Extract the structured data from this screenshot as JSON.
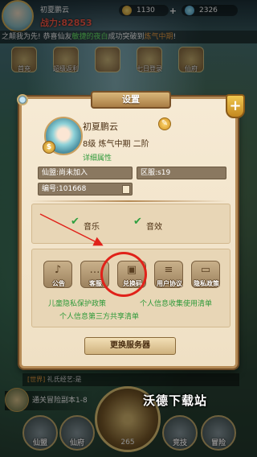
{
  "hud": {
    "player_name": "初夏鹏云",
    "power_label": "战力:82853",
    "currency_1": "1130",
    "currency_2": "2326",
    "broadcast_prefix": "之颠我为先! 恭喜仙友",
    "broadcast_name": "敏捷的夜白",
    "broadcast_mid": "成功突破到",
    "broadcast_realm": "炼气中期",
    "broadcast_suffix": "!",
    "top_icons": [
      "首充",
      "超级返利",
      "",
      "七日登录",
      "仙府"
    ],
    "chat_tag": "[世界]",
    "chat_text": "礼氏经艺:是",
    "quest_text": "通关冒险副本1-8",
    "hammer_count": "265",
    "nav": [
      "仙盟",
      "仙府",
      "",
      "竞技",
      "冒险"
    ],
    "watermark": "沃德下载站"
  },
  "dialog": {
    "title": "设置",
    "close_label": "+",
    "profile": {
      "name": "初夏鹏云",
      "level": "8级 炼气中期 二阶",
      "detail_link": "详细属性"
    },
    "fields": {
      "guild": "仙盟:尚未加入",
      "server": "区服:s19",
      "id": "编号:101668"
    },
    "sound": {
      "music_label": "音乐",
      "sfx_label": "音效"
    },
    "actions": [
      {
        "label": "公告",
        "glyph": "♪"
      },
      {
        "label": "客服",
        "glyph": "…"
      },
      {
        "label": "兑换码",
        "glyph": "▣"
      },
      {
        "label": "用户协议",
        "glyph": "≡"
      },
      {
        "label": "隐私政策",
        "glyph": "▭"
      }
    ],
    "links": {
      "child_privacy": "儿童隐私保护政策",
      "info_collect": "个人信息收集使用清单",
      "third_party": "个人信息第三方共享清单"
    },
    "server_button": "更换服务器"
  },
  "colors": {
    "link_green": "#2f9a3a",
    "dialog_bg": "#f6ead4",
    "annotation_red": "#e0221a"
  }
}
